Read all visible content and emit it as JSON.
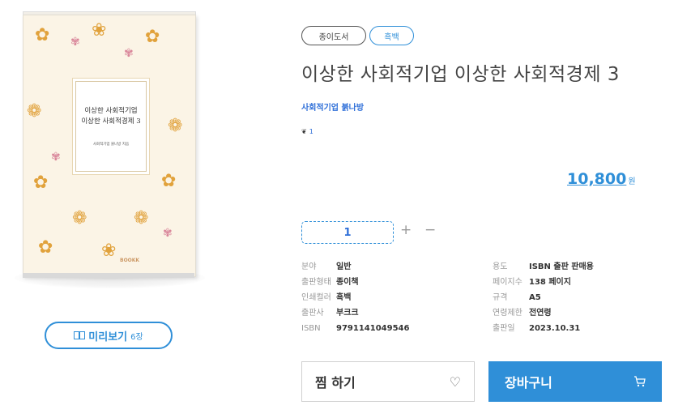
{
  "book": {
    "cover_title_line1": "이상한 사회적기업",
    "cover_title_line2": "이상한 사회적경제 3",
    "cover_author": "사회적기업 붉나방 지음",
    "cover_logo": "BOOKK"
  },
  "preview": {
    "label": "미리보기",
    "count": "6장"
  },
  "tags": [
    "종이도서",
    "흑백"
  ],
  "title": "이상한 사회적기업 이상한 사회적경제 3",
  "publisher": "사회적기업 붉나방",
  "likes": "1",
  "price": {
    "amount": "10,800",
    "unit": "원"
  },
  "quantity": {
    "value": "1",
    "plus": "+",
    "minus": "−"
  },
  "specs_left": [
    {
      "key": "분야",
      "value": "일반"
    },
    {
      "key": "출판형태",
      "value": "종이책"
    },
    {
      "key": "인쇄컬러",
      "value": "흑백"
    },
    {
      "key": "출판사",
      "value": "부크크"
    },
    {
      "key": "ISBN",
      "value": "9791141049546"
    }
  ],
  "specs_right": [
    {
      "key": "용도",
      "value": "ISBN 출판 판매용"
    },
    {
      "key": "페이지수",
      "value": "138 페이지"
    },
    {
      "key": "규격",
      "value": "A5"
    },
    {
      "key": "연령제한",
      "value": "전연령"
    },
    {
      "key": "출판일",
      "value": "2023.10.31"
    }
  ],
  "buttons": {
    "wish": "찜 하기",
    "cart": "장바구니"
  },
  "colors": {
    "accent": "#2f8fd8",
    "cover_bg": "#fbf4e6",
    "flower": "#e1a23c"
  },
  "icons": [
    "book-open-icon",
    "heart-icon",
    "cart-icon"
  ]
}
